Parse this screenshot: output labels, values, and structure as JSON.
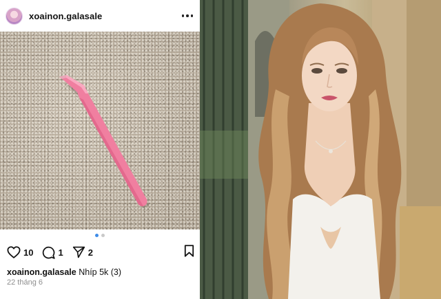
{
  "post": {
    "username": "xoainon.galasale",
    "likes": "10",
    "comments": "1",
    "shares": "2",
    "caption_user": "xoainon.galasale",
    "caption_text": "Nhíp 5k (3)",
    "date": "22 tháng 6",
    "carousel": {
      "count": 2,
      "active": 1
    }
  },
  "icons": {
    "avatar": "avatar",
    "more": "more-dots-icon",
    "like": "heart-icon",
    "comment": "comment-icon",
    "share": "send-icon",
    "save": "bookmark-icon"
  },
  "colors": {
    "carousel_active": "#3f8ce8",
    "tweezers": "#f07fa0"
  }
}
